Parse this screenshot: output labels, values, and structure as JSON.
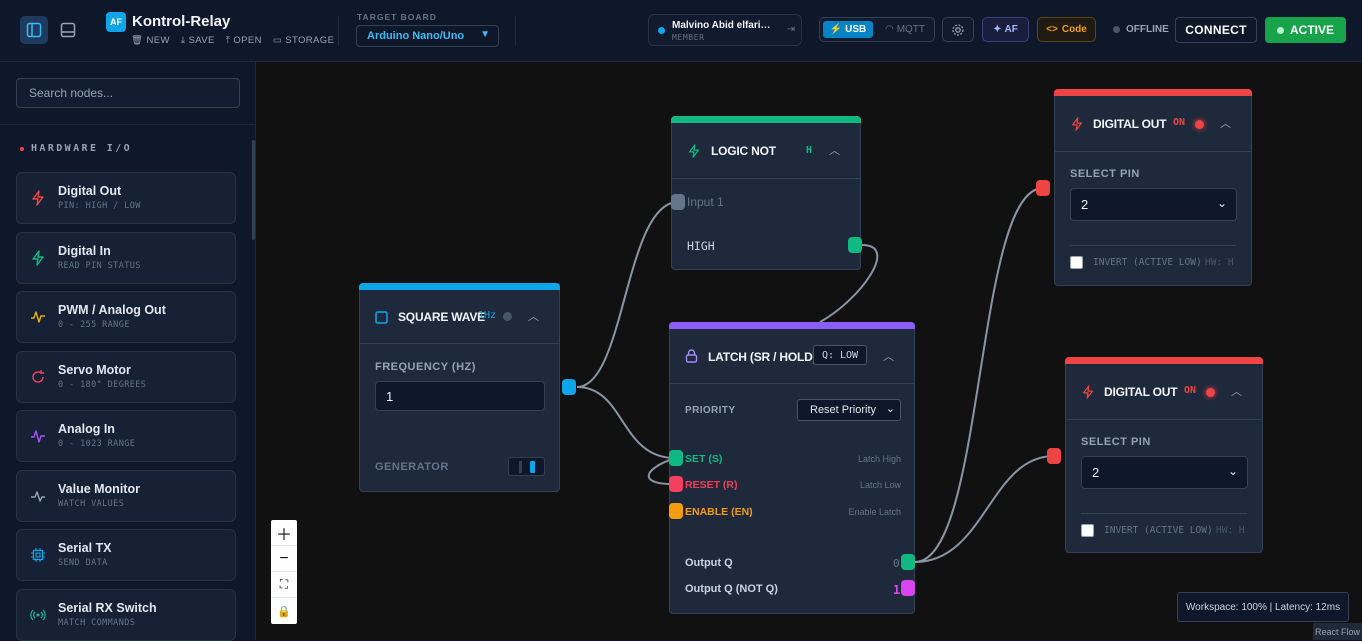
{
  "app": {
    "logo_text": "AF",
    "title": "Kontrol-Relay",
    "actions": [
      "NEW",
      "SAVE",
      "OPEN",
      "STORAGE"
    ]
  },
  "board": {
    "label": "TARGET BOARD",
    "selected": "Arduino Nano/Uno"
  },
  "user": {
    "name": "Malvino Abid elfari…",
    "role": "MEMBER"
  },
  "connection": {
    "usb_label": "USB",
    "mqtt_label": "MQTT",
    "selected": "USB",
    "status": "OFFLINE"
  },
  "toolbar": {
    "af_label": "AF",
    "code_label": "Code",
    "connect_label": "CONNECT",
    "active_label": "ACTIVE"
  },
  "sidebar": {
    "search_placeholder": "Search nodes...",
    "section_title": "HARDWARE I/O",
    "items": [
      {
        "name": "Digital Out",
        "sub": "PIN: HIGH / LOW",
        "icon": "bolt-icon",
        "color": "#ef4444"
      },
      {
        "name": "Digital In",
        "sub": "READ PIN STATUS",
        "icon": "bolt-icon",
        "color": "#10b981"
      },
      {
        "name": "PWM / Analog Out",
        "sub": "0 - 255 RANGE",
        "icon": "wave-icon",
        "color": "#eab308"
      },
      {
        "name": "Servo Motor",
        "sub": "0 - 180° DEGREES",
        "icon": "rotate-icon",
        "color": "#f43f5e"
      },
      {
        "name": "Analog In",
        "sub": "0 - 1023 RANGE",
        "icon": "pulse-icon",
        "color": "#a855f7"
      },
      {
        "name": "Value Monitor",
        "sub": "WATCH VALUES",
        "icon": "monitor-pulse-icon",
        "color": "#94a3b8"
      },
      {
        "name": "Serial TX",
        "sub": "SEND DATA",
        "icon": "chip-icon",
        "color": "#0ea5e9"
      },
      {
        "name": "Serial RX Switch",
        "sub": "MATCH COMMANDS",
        "icon": "radio-icon",
        "color": "#14b8a6"
      }
    ]
  },
  "nodes": {
    "square_wave": {
      "title": "SQUARE WAVE",
      "badge": "1Hz",
      "freq_label": "FREQUENCY (HZ)",
      "freq_value": "1",
      "gen_label": "GENERATOR",
      "color": "#0ea5e9"
    },
    "logic_not": {
      "title": "LOGIC NOT",
      "badge": "H",
      "input_label": "Input 1",
      "output_label": "HIGH",
      "color": "#10b981"
    },
    "latch": {
      "title": "LATCH (SR / HOLD)",
      "badge": "Q: LOW",
      "priority_label": "PRIORITY",
      "priority_value": "Reset Priority",
      "set_label": "SET (S)",
      "set_hint": "Latch High",
      "reset_label": "RESET (R)",
      "reset_hint": "Latch Low",
      "enable_label": "ENABLE (EN)",
      "enable_hint": "Enable Latch",
      "out_q_label": "Output Q",
      "out_q_value": "0",
      "out_nq_label": "Output Q (NOT Q)",
      "out_nq_value": "1",
      "color": "#8b5cf6"
    },
    "digital_out_1": {
      "title": "DIGITAL OUT",
      "state": "ON",
      "pin_label": "SELECT PIN",
      "pin_value": "2",
      "invert_label": "INVERT (ACTIVE LOW)",
      "hw_label": "HW: H",
      "color": "#ef4444"
    },
    "digital_out_2": {
      "title": "DIGITAL OUT",
      "state": "ON",
      "pin_label": "SELECT PIN",
      "pin_value": "2",
      "invert_label": "INVERT (ACTIVE LOW)",
      "hw_label": "HW: H",
      "color": "#ef4444"
    }
  },
  "status": {
    "text": "Workspace: 100% | Latency: 12ms"
  },
  "attribution": "React Flow"
}
